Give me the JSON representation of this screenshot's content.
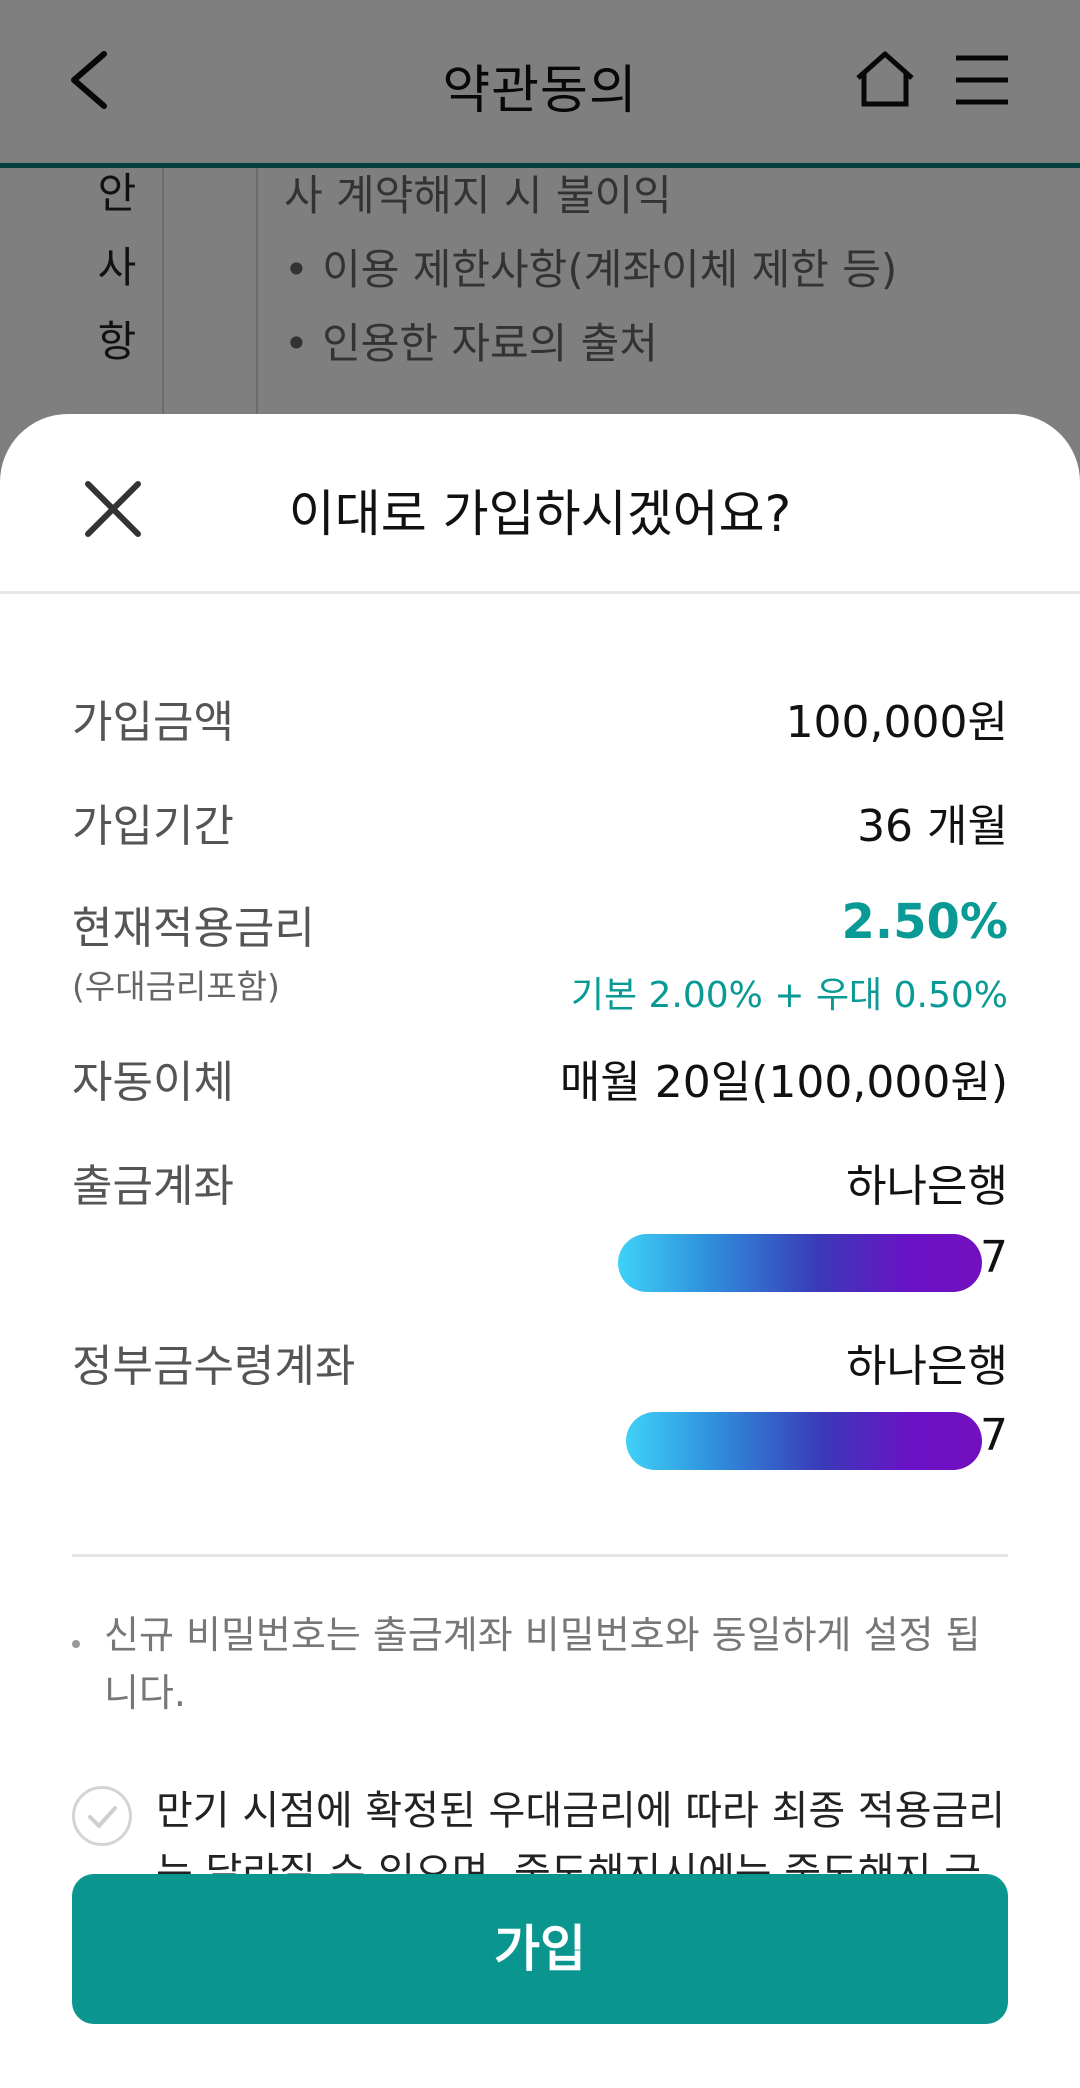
{
  "header": {
    "title": "약관동의"
  },
  "background": {
    "side_chars": [
      "안",
      "사",
      "항"
    ],
    "lines": [
      "사 계약해지 시 불이익",
      "• 이용 제한사항(계좌이체 제한 등)",
      "• 인용한 자료의 출처"
    ]
  },
  "sheet": {
    "title": "이대로 가입하시겠어요?",
    "amount": {
      "label": "가입금액",
      "value": "100,000원"
    },
    "period": {
      "label": "가입기간",
      "value": "36 개월"
    },
    "rate": {
      "label": "현재적용금리",
      "sublabel": "(우대금리포함)",
      "value": "2.50%",
      "detail": "기본 2.00% + 우대 0.50%"
    },
    "autotransfer": {
      "label": "자동이체",
      "value": "매월 20일(100,000원)"
    },
    "withdraw_account": {
      "label": "출금계좌",
      "bank": "하나은행",
      "tail": "7"
    },
    "subsidy_account": {
      "label": "정부금수령계좌",
      "bank": "하나은행",
      "tail": "7"
    },
    "notice": "신규 비밀번호는 출금계좌 비밀번호와 동일하게 설정 됩니다.",
    "agreement": "만기 시점에 확정된 우대금리에 따라 최종 적용금리는 달라질 수 있으며, 중도해지시에는 중도해지 금리",
    "join_label": "가입"
  },
  "colors": {
    "accent": "#0a968f",
    "rate_text": "#0a9a95",
    "header_line": "#0a7f7c"
  }
}
